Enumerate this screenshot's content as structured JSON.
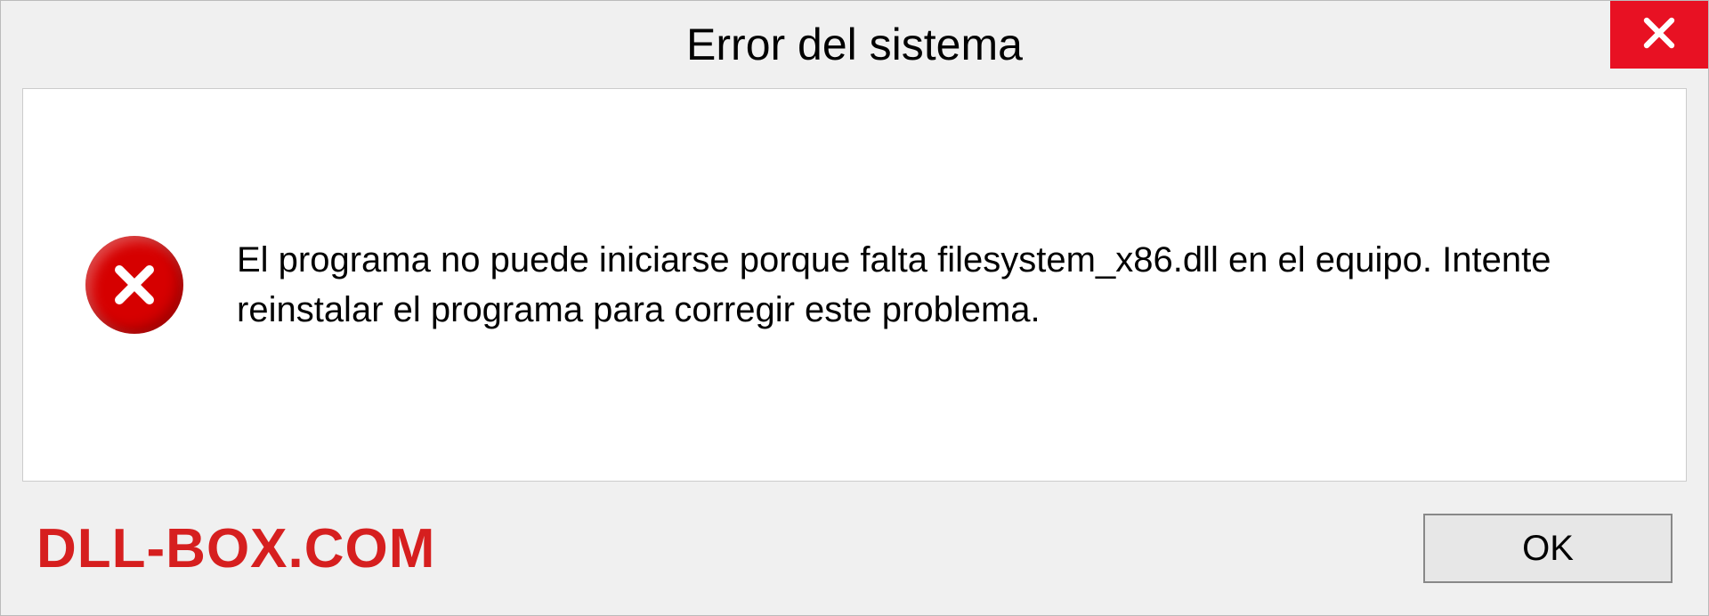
{
  "dialog": {
    "title": "Error del sistema",
    "message": "El programa no puede iniciarse porque falta filesystem_x86.dll en el equipo. Intente reinstalar el programa para corregir este problema.",
    "ok_label": "OK",
    "watermark": "DLL-BOX.COM"
  }
}
